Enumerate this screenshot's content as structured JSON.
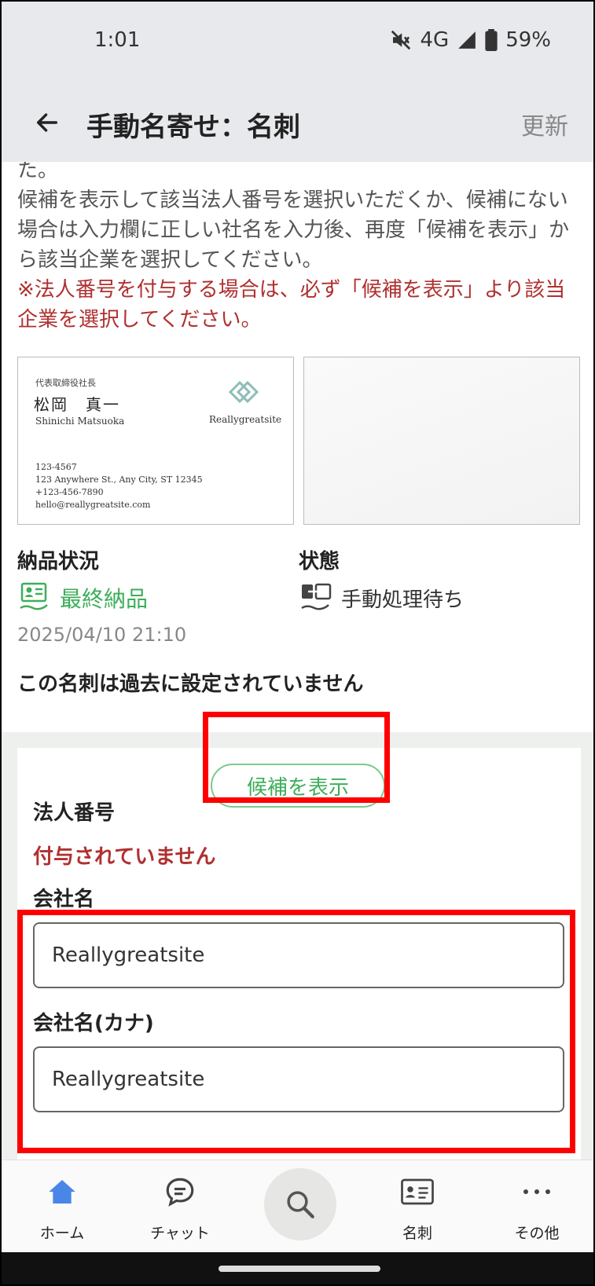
{
  "status_bar": {
    "time": "1:01",
    "network": "4G",
    "battery": "59%"
  },
  "app_bar": {
    "title": "手動名寄せ：名刺",
    "refresh_label": "更新"
  },
  "description": {
    "line0": "た。",
    "body": "候補を表示して該当法人番号を選択いただくか、候補にない場合は入力欄に正しい社名を入力後、再度「候補を表示」から該当企業を選択してください。",
    "warning": "※法人番号を付与する場合は、必ず「候補を表示」より該当企業を選択してください。"
  },
  "business_card": {
    "title": "代表取締役社長",
    "name": "松岡　真一",
    "name_roman": "Shinichi Matsuoka",
    "brand": "Reallygreatsite",
    "postal": "123-4567",
    "address": "123 Anywhere St., Any City, ST 12345",
    "phone": "+123-456-7890",
    "email": "hello@reallygreatsite.com"
  },
  "delivery": {
    "label": "納品状況",
    "value": "最終納品",
    "datetime": "2025/04/10 21:10"
  },
  "state": {
    "label": "状態",
    "value": "手動処理待ち"
  },
  "notice": "この名刺は過去に設定されていません",
  "form": {
    "candidate_button": "候補を表示",
    "corp_number_label": "法人番号",
    "corp_number_value": "付与されていません",
    "company_name_label": "会社名",
    "company_name_value": "Reallygreatsite",
    "company_kana_label": "会社名(カナ)",
    "company_kana_value": "Reallygreatsite"
  },
  "bottom_nav": {
    "home": "ホーム",
    "chat": "チャット",
    "card": "名刺",
    "other": "その他"
  },
  "colors": {
    "accent_green": "#3dae5a",
    "warning_red": "#b03030",
    "highlight_red": "#ff0000",
    "nav_blue": "#4a86e8"
  }
}
